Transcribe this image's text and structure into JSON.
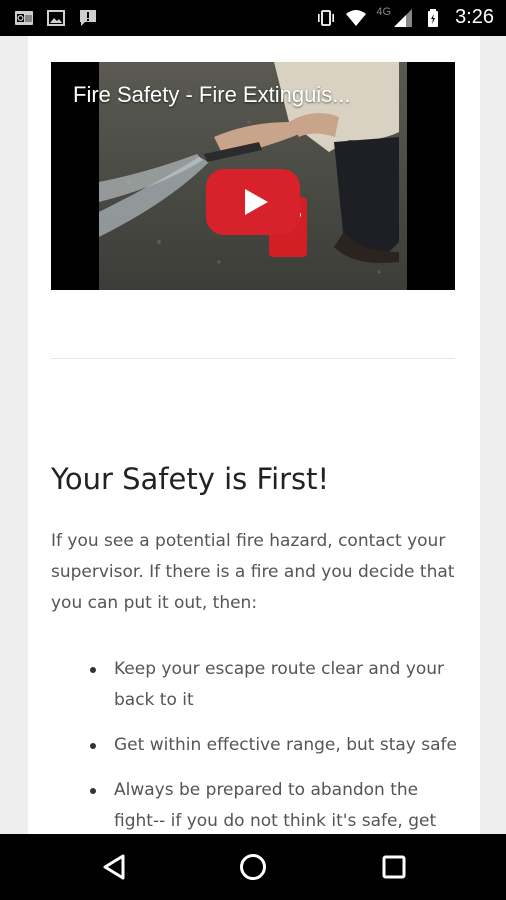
{
  "status_bar": {
    "time": "3:26",
    "network_label": "4G",
    "left_icons": [
      "outlook-icon",
      "image-icon",
      "alert-message-icon"
    ],
    "right_icons": [
      "vibrate-icon",
      "wifi-icon",
      "signal-icon",
      "battery-icon"
    ]
  },
  "video": {
    "title": "Fire Safety - Fire Extinguis...",
    "play_icon": "play-icon",
    "accent_color": "#d8222b"
  },
  "article": {
    "heading": "Your Safety is First!",
    "intro": "If you see a potential fire hazard, contact your supervisor. If there is a fire and you decide that you can put it out, then:",
    "bullets": [
      "Keep your escape route clear and your back to it",
      "Get within effective range, but stay safe",
      "Always be prepared to abandon the fight-- if you do not think it's safe, get"
    ]
  },
  "nav_bar": {
    "icons": [
      "back-icon",
      "home-icon",
      "recents-icon"
    ]
  }
}
